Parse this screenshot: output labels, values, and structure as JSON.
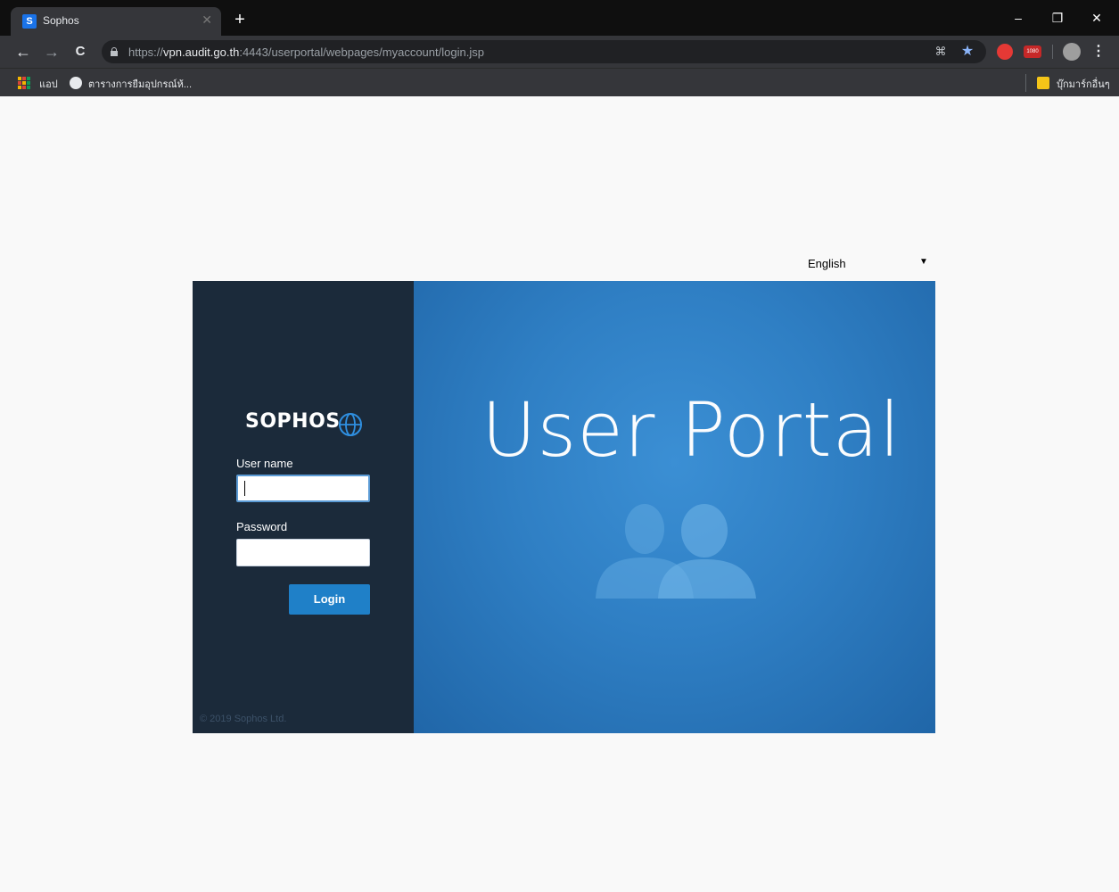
{
  "browser": {
    "tab_title": "Sophos",
    "tab_favicon": "S",
    "new_tab": "+",
    "url_scheme": "https://",
    "url_host": "vpn.audit.go.th",
    "url_rest": ":4443/userportal/webpages/myaccount/login.jsp",
    "bookmarks": {
      "apps_label": "แอป",
      "item_1": "ตารางการยืมอุปกรณ์ห้...",
      "other_bookmarks": "บุ๊กมาร์กอื่นๆ"
    },
    "window_controls": {
      "minimize": "–",
      "restore": "❐",
      "close": "✕"
    },
    "nav": {
      "back": "←",
      "forward": "→",
      "reload": "C"
    },
    "ext_badge": "1080"
  },
  "page": {
    "language": {
      "selected": "English",
      "arrow": "▼"
    },
    "brand": "SOPHOS",
    "username_label": "User name",
    "username_value": "",
    "password_label": "Password",
    "password_value": "",
    "login_button": "Login",
    "copyright": "© 2019 Sophos Ltd.",
    "portal_title": "User Portal"
  },
  "colors": {
    "left_panel": "#1b2a3a",
    "accent": "#1f80c8",
    "right_panel": "#2f7fc4"
  }
}
